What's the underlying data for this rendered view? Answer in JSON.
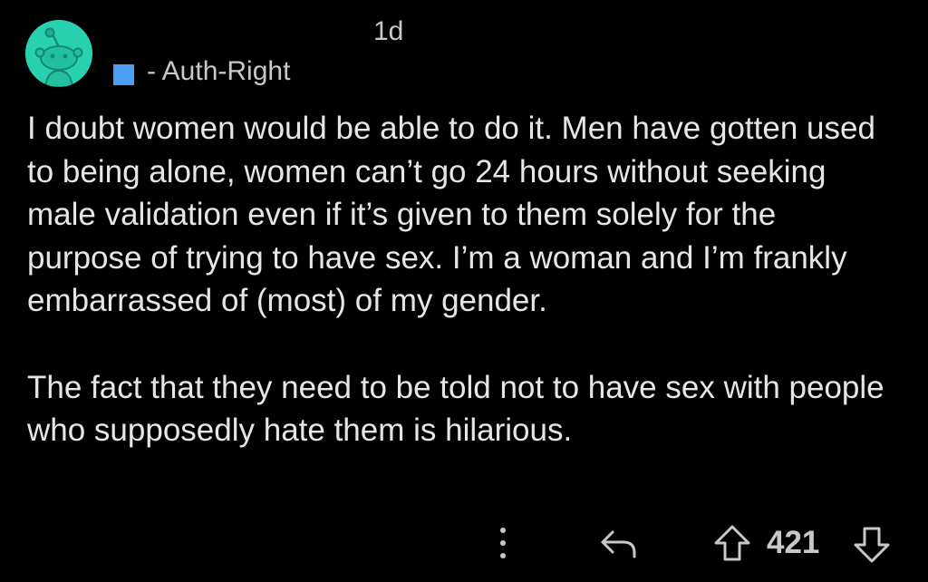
{
  "comment": {
    "timestamp": "1d",
    "flair": "- Auth-Right",
    "paragraphs": [
      "I doubt women would be able to do it. Men have gotten used to being alone, women can’t go 24 hours without seeking male validation even if it’s given to them solely for the purpose of trying to have sex. I’m a woman and I’m frankly embarrassed of (most) of my gender.",
      "The fact that they need to be told not to have sex with people who supposedly hate them is hilarious."
    ],
    "score": "421"
  },
  "icons": {
    "avatar": "snoo-avatar-icon",
    "more": "more-vertical-icon",
    "reply": "reply-icon",
    "upvote": "upvote-icon",
    "downvote": "downvote-icon"
  },
  "colors": {
    "background": "#000000",
    "avatar_bg": "#2ad1b0",
    "flair_square": "#4a9ef5",
    "text": "#e6e6e6",
    "meta_text": "#c8c8c8"
  }
}
